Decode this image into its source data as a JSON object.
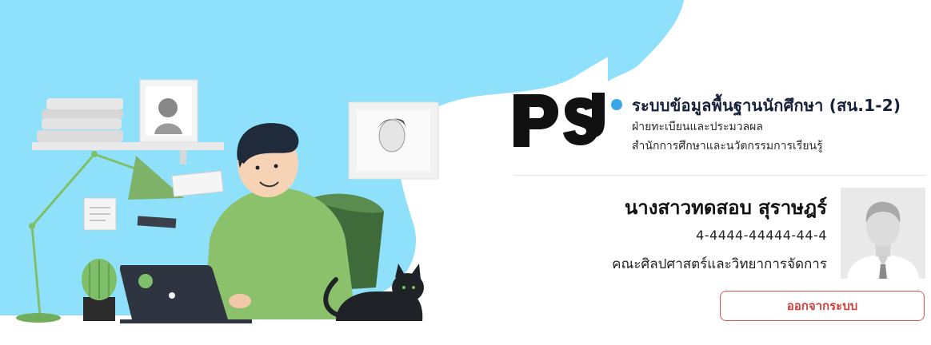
{
  "brand": {
    "logo_text": "PSU",
    "title": "ระบบข้อมูลพื้นฐานนักศึกษา (สน.1-2)",
    "subtitle_1": "ฝ่ายทะเบียนและประมวลผล",
    "subtitle_2": "สำนักการศึกษาและนวัตกรรมการเรียนรู้",
    "accent_color": "#3aa6e6"
  },
  "user": {
    "name": "นางสาวทดสอบ สุราษฎร์",
    "id_number": "4-4444-44444-44-4",
    "faculty": "คณะศิลปศาสตร์และวิทยาการจัดการ"
  },
  "actions": {
    "logout_label": "ออกจากระบบ",
    "logout_color": "#d9534f"
  },
  "illustration": {
    "background_color": "#8fe1fb",
    "icons": [
      "man-at-laptop-illustration",
      "cat-icon",
      "cactus-icon",
      "desk-lamp-icon",
      "picture-frame-icon"
    ]
  }
}
